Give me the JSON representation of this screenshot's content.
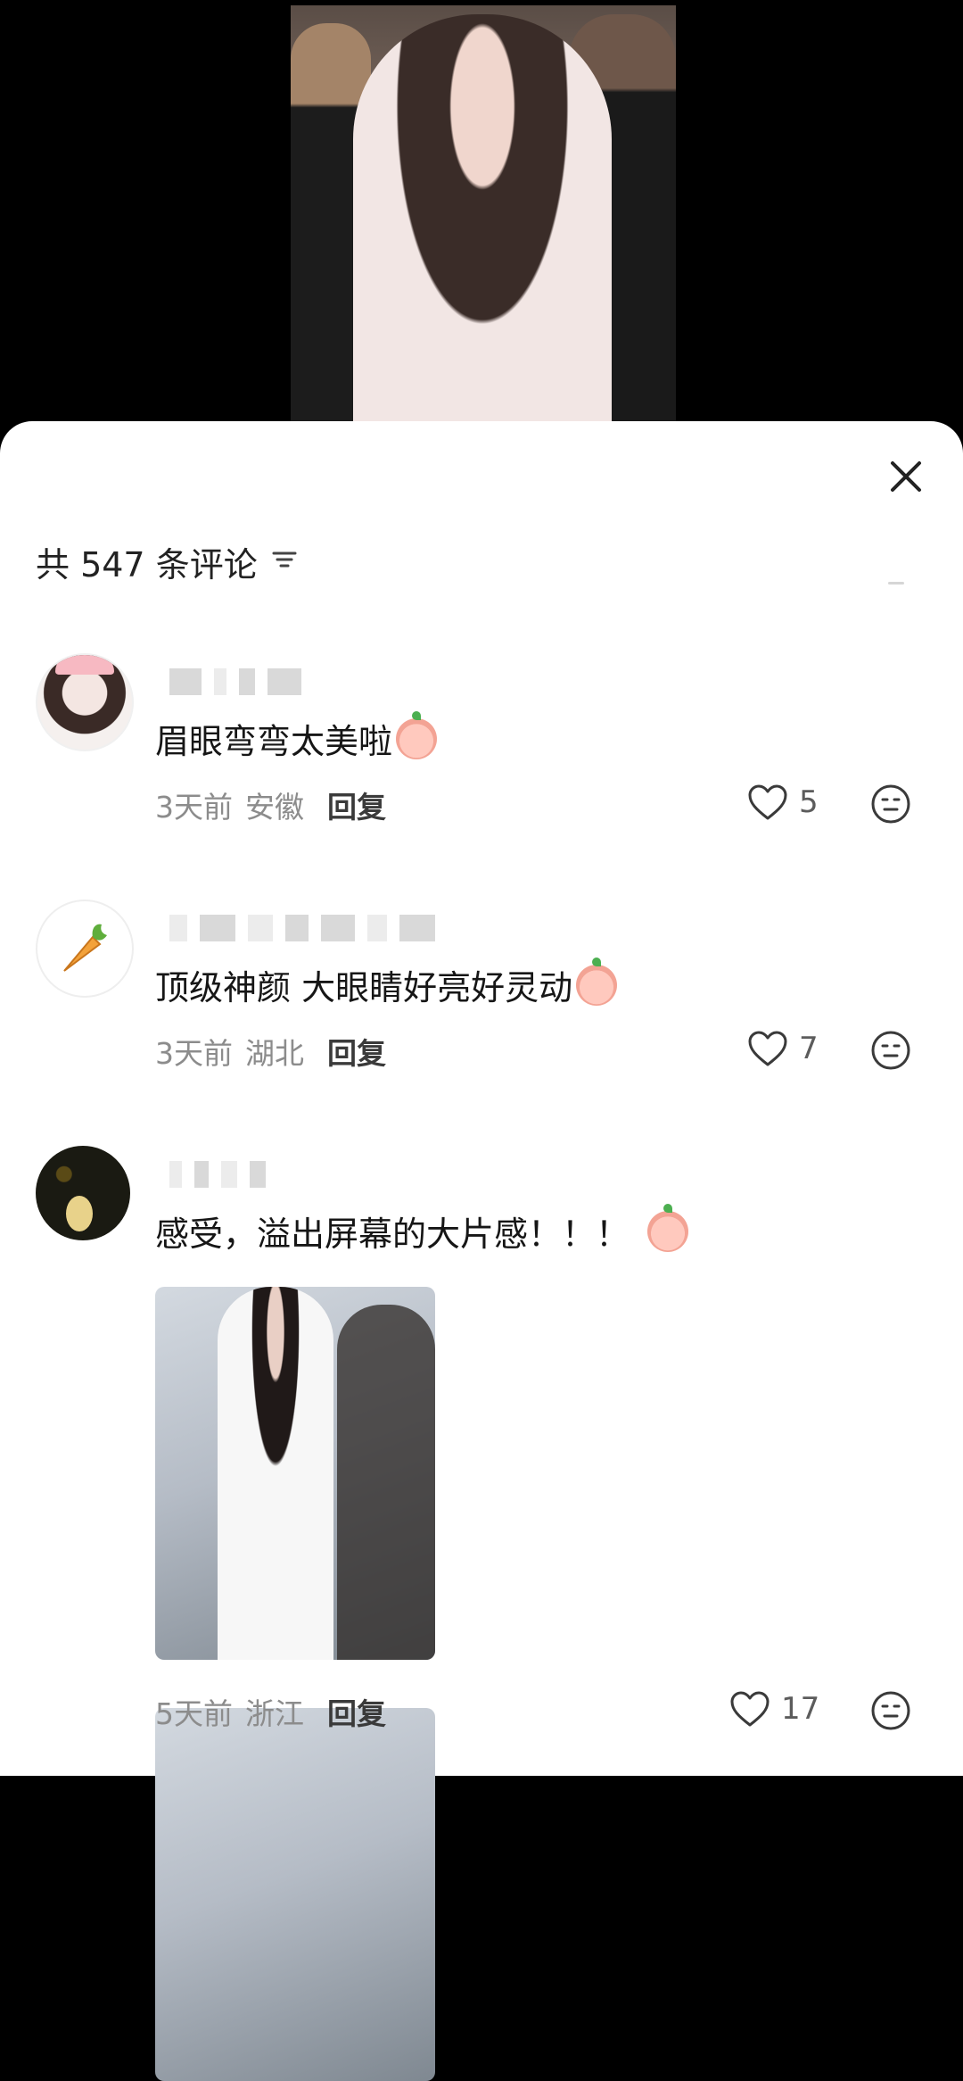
{
  "header": {
    "comment_count_label": "共 547 条评论"
  },
  "icons": {
    "close": "close-icon",
    "filter": "filter-icon",
    "heart": "heart-icon",
    "reaction": "emoji-reaction-icon"
  },
  "comments": [
    {
      "text": "眉眼弯弯太美啦",
      "time": "3天前",
      "location": "安徽",
      "reply_label": "回复",
      "likes": "5"
    },
    {
      "text": "顶级神颜  大眼睛好亮好灵动",
      "time": "3天前",
      "location": "湖北",
      "reply_label": "回复",
      "likes": "7"
    },
    {
      "text": "感受，溢出屏幕的大片感！！！",
      "time": "5天前",
      "location": "浙江",
      "reply_label": "回复",
      "likes": "17"
    }
  ],
  "colors": {
    "sheet_background": "#ffffff",
    "meta_text": "#8c8c8c",
    "primary_text": "#161616"
  }
}
